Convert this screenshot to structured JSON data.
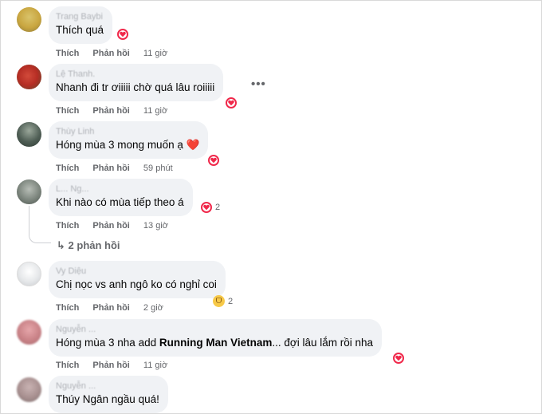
{
  "actions": {
    "like": "Thích",
    "reply": "Phản hồi"
  },
  "comments": [
    {
      "author": "Trang Baybi",
      "text": "Thích quá",
      "time": "11 giờ",
      "reaction": "heart",
      "reaction_count": ""
    },
    {
      "author": "Lệ Thanh.",
      "text": "Nhanh đi tr ơiiiii chờ quá lâu roiiiii",
      "time": "11 giờ",
      "reaction": "heart",
      "reaction_count": ""
    },
    {
      "author": "Thùy Linh",
      "text": "Hóng mùa 3 mong muốn ạ ❤️",
      "time": "59 phút",
      "reaction": "heart",
      "reaction_count": ""
    },
    {
      "author": "L... Ng...",
      "text": "Khi nào có mùa tiếp theo á",
      "time": "13 giờ",
      "reaction": "heart",
      "reaction_count": "2"
    },
    {
      "author": "Vy Diệu",
      "text": "Chị nọc vs anh ngô ko có nghỉ coi",
      "time": "2 giờ",
      "reaction": "haha",
      "reaction_count": "2"
    },
    {
      "author": "Nguyễn ...",
      "text_before": "Hóng mùa 3 nha add ",
      "text_bold": "Running Man Vietnam",
      "text_after": "... đợi lâu lắm rồi nha",
      "time": "11 giờ",
      "reaction": "heart",
      "reaction_count": ""
    },
    {
      "author": "Nguyễn ...",
      "text": "Thúy Ngân ngầu quá!"
    }
  ],
  "replies_link": "2 phản hồi",
  "more_menu": "•••"
}
